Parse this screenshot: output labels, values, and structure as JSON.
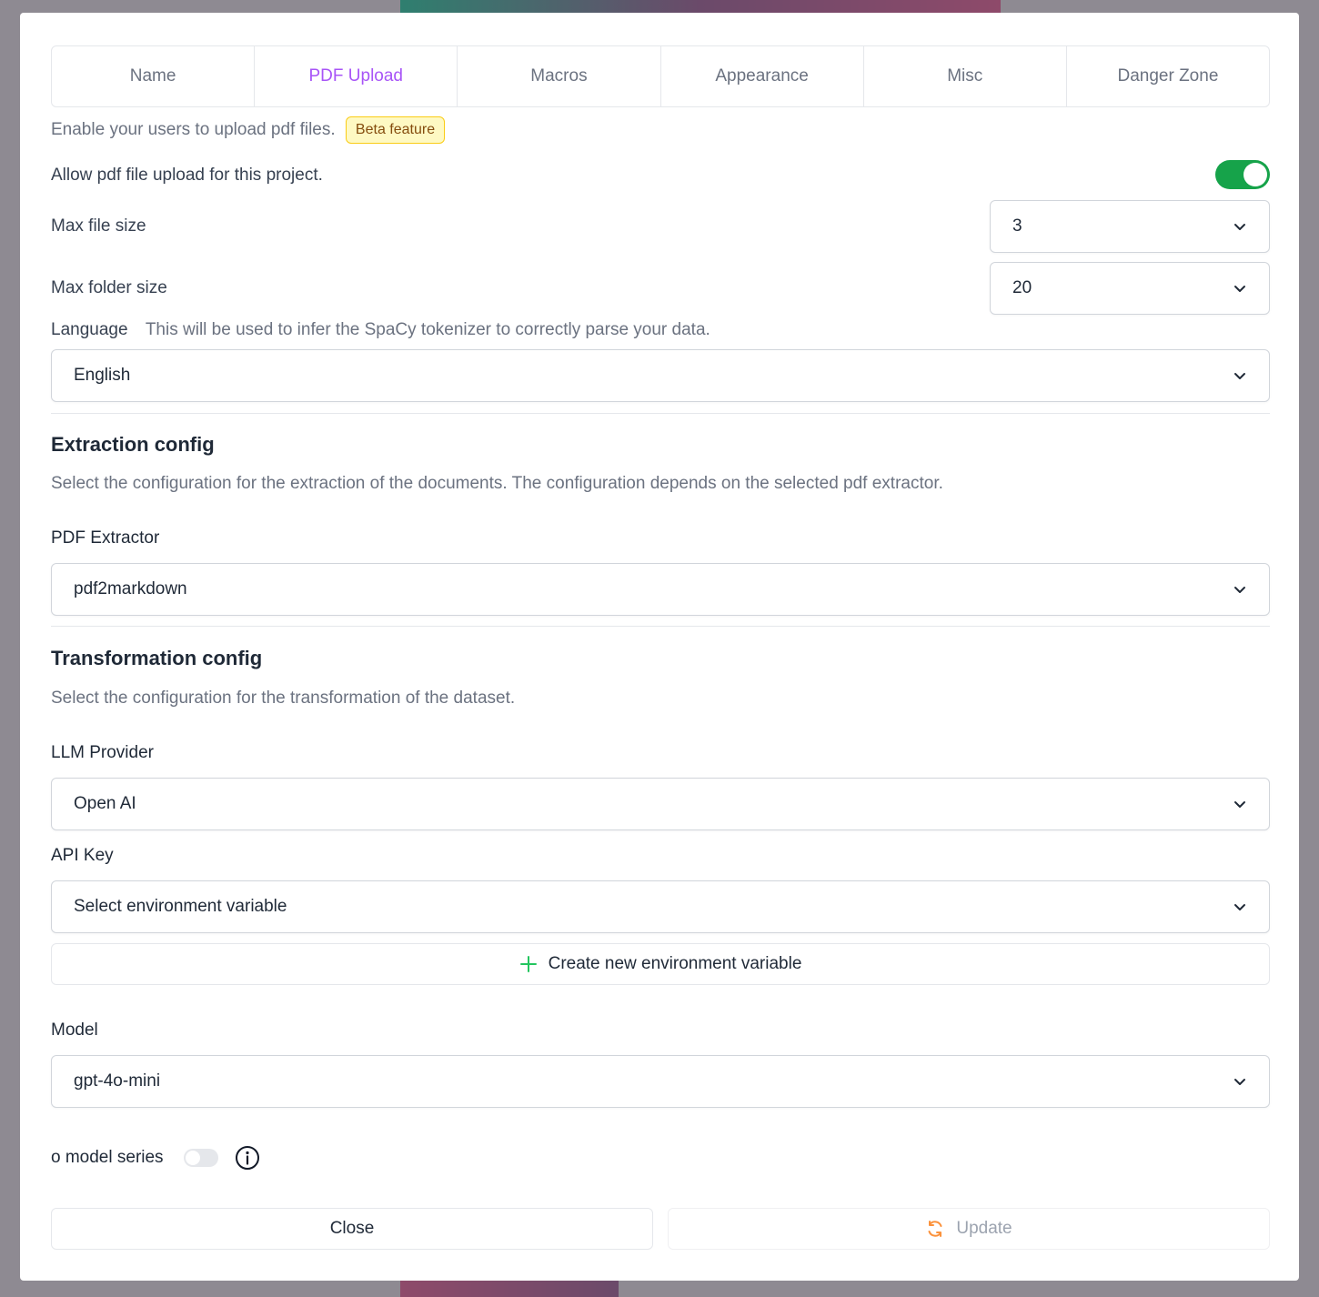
{
  "tabs": [
    {
      "label": "Name",
      "active": false
    },
    {
      "label": "PDF Upload",
      "active": true
    },
    {
      "label": "Macros",
      "active": false
    },
    {
      "label": "Appearance",
      "active": false
    },
    {
      "label": "Misc",
      "active": false
    },
    {
      "label": "Danger Zone",
      "active": false
    }
  ],
  "intro": {
    "text": "Enable your users to upload pdf files.",
    "badge": "Beta feature"
  },
  "allow_upload": {
    "label": "Allow pdf file upload for this project.",
    "enabled": true
  },
  "max_file_size": {
    "label": "Max file size",
    "value": "3"
  },
  "max_folder_size": {
    "label": "Max folder size",
    "value": "20"
  },
  "language": {
    "label": "Language",
    "hint": "This will be used to infer the SpaCy tokenizer to correctly parse your data.",
    "value": "English"
  },
  "extraction": {
    "title": "Extraction config",
    "description": "Select the configuration for the extraction of the documents. The configuration depends on the selected pdf extractor.",
    "extractor_label": "PDF Extractor",
    "extractor_value": "pdf2markdown"
  },
  "transformation": {
    "title": "Transformation config",
    "description": "Select the configuration for the transformation of the dataset.",
    "provider_label": "LLM Provider",
    "provider_value": "Open AI",
    "api_key_label": "API Key",
    "api_key_value": "Select environment variable",
    "create_env_label": "Create new environment variable",
    "model_label": "Model",
    "model_value": "gpt-4o-mini",
    "o_series_label": "o model series",
    "o_series_enabled": false
  },
  "footer": {
    "close_label": "Close",
    "update_label": "Update"
  },
  "colors": {
    "accent": "#a855f7",
    "toggle_on": "#16a34a",
    "badge_bg": "#fef9c3",
    "badge_border": "#facc15",
    "plus_icon": "#22c55e",
    "update_icon": "#fb923c"
  }
}
